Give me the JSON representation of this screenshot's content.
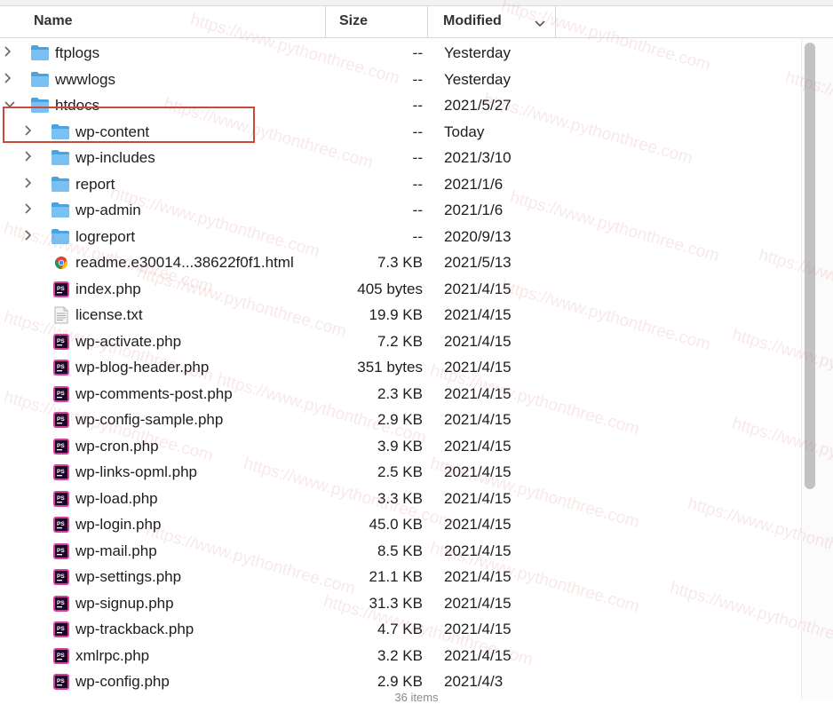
{
  "columns": {
    "name": "Name",
    "size": "Size",
    "modified": "Modified"
  },
  "rows": [
    {
      "name": "ftplogs",
      "size": "--",
      "modified": "Yesterday",
      "kind": "folder",
      "indent": 0,
      "expand": "collapsed"
    },
    {
      "name": "wwwlogs",
      "size": "--",
      "modified": "Yesterday",
      "kind": "folder",
      "indent": 0,
      "expand": "collapsed"
    },
    {
      "name": "htdocs",
      "size": "--",
      "modified": "2021/5/27",
      "kind": "folder",
      "indent": 0,
      "expand": "expanded"
    },
    {
      "name": "wp-content",
      "size": "--",
      "modified": "Today",
      "kind": "folder",
      "indent": 1,
      "expand": "collapsed"
    },
    {
      "name": "wp-includes",
      "size": "--",
      "modified": "2021/3/10",
      "kind": "folder",
      "indent": 1,
      "expand": "collapsed"
    },
    {
      "name": "report",
      "size": "--",
      "modified": "2021/1/6",
      "kind": "folder",
      "indent": 1,
      "expand": "collapsed"
    },
    {
      "name": "wp-admin",
      "size": "--",
      "modified": "2021/1/6",
      "kind": "folder",
      "indent": 1,
      "expand": "collapsed"
    },
    {
      "name": "logreport",
      "size": "--",
      "modified": "2020/9/13",
      "kind": "folder",
      "indent": 1,
      "expand": "collapsed"
    },
    {
      "name": "readme.e30014...38622f0f1.html",
      "size": "7.3 KB",
      "modified": "2021/5/13",
      "kind": "html",
      "indent": 1,
      "expand": "none"
    },
    {
      "name": "index.php",
      "size": "405 bytes",
      "modified": "2021/4/15",
      "kind": "php",
      "indent": 1,
      "expand": "none"
    },
    {
      "name": "license.txt",
      "size": "19.9 KB",
      "modified": "2021/4/15",
      "kind": "txt",
      "indent": 1,
      "expand": "none"
    },
    {
      "name": "wp-activate.php",
      "size": "7.2 KB",
      "modified": "2021/4/15",
      "kind": "php",
      "indent": 1,
      "expand": "none"
    },
    {
      "name": "wp-blog-header.php",
      "size": "351 bytes",
      "modified": "2021/4/15",
      "kind": "php",
      "indent": 1,
      "expand": "none"
    },
    {
      "name": "wp-comments-post.php",
      "size": "2.3 KB",
      "modified": "2021/4/15",
      "kind": "php",
      "indent": 1,
      "expand": "none"
    },
    {
      "name": "wp-config-sample.php",
      "size": "2.9 KB",
      "modified": "2021/4/15",
      "kind": "php",
      "indent": 1,
      "expand": "none"
    },
    {
      "name": "wp-cron.php",
      "size": "3.9 KB",
      "modified": "2021/4/15",
      "kind": "php",
      "indent": 1,
      "expand": "none"
    },
    {
      "name": "wp-links-opml.php",
      "size": "2.5 KB",
      "modified": "2021/4/15",
      "kind": "php",
      "indent": 1,
      "expand": "none"
    },
    {
      "name": "wp-load.php",
      "size": "3.3 KB",
      "modified": "2021/4/15",
      "kind": "php",
      "indent": 1,
      "expand": "none"
    },
    {
      "name": "wp-login.php",
      "size": "45.0 KB",
      "modified": "2021/4/15",
      "kind": "php",
      "indent": 1,
      "expand": "none"
    },
    {
      "name": "wp-mail.php",
      "size": "8.5 KB",
      "modified": "2021/4/15",
      "kind": "php",
      "indent": 1,
      "expand": "none"
    },
    {
      "name": "wp-settings.php",
      "size": "21.1 KB",
      "modified": "2021/4/15",
      "kind": "php",
      "indent": 1,
      "expand": "none"
    },
    {
      "name": "wp-signup.php",
      "size": "31.3 KB",
      "modified": "2021/4/15",
      "kind": "php",
      "indent": 1,
      "expand": "none"
    },
    {
      "name": "wp-trackback.php",
      "size": "4.7 KB",
      "modified": "2021/4/15",
      "kind": "php",
      "indent": 1,
      "expand": "none"
    },
    {
      "name": "xmlrpc.php",
      "size": "3.2 KB",
      "modified": "2021/4/15",
      "kind": "php",
      "indent": 1,
      "expand": "none"
    },
    {
      "name": "wp-config.php",
      "size": "2.9 KB",
      "modified": "2021/4/3",
      "kind": "php",
      "indent": 1,
      "expand": "none"
    }
  ],
  "footer": {
    "status": "36 items"
  },
  "watermark": "https://www.pythonthree.com",
  "colors": {
    "highlight": "#c94a3a",
    "folder": "#5fb3ec",
    "ps_icon": "#2a0a3a",
    "ps_accent": "#d6409f"
  }
}
